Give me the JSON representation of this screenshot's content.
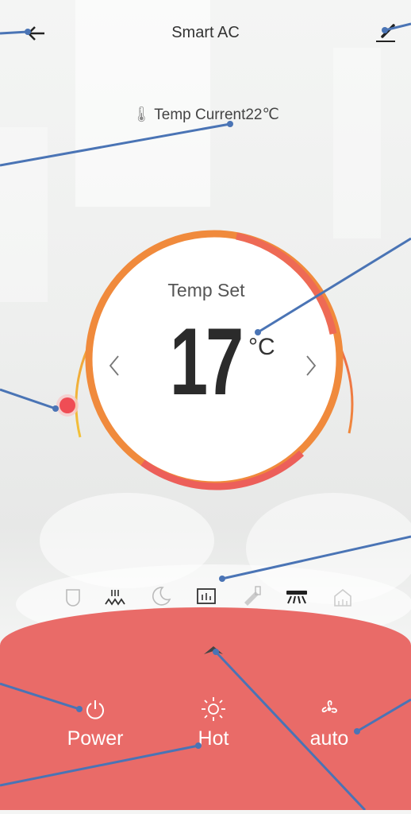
{
  "header": {
    "title": "Smart AC",
    "back_icon": "back-arrow-icon",
    "edit_icon": "edit-pen-icon"
  },
  "current_temp": {
    "label": "Temp Current22℃",
    "icon": "thermometer-icon"
  },
  "dial": {
    "label": "Temp Set",
    "value": "17",
    "unit": "°C",
    "prev_icon": "chevron-left-icon",
    "next_icon": "chevron-right-icon",
    "colors": {
      "ring": "#f08a3c",
      "accent": "#e94f55",
      "knob": "#ef4d55"
    }
  },
  "modes": [
    {
      "name": "eco-mode-icon",
      "active": false
    },
    {
      "name": "heat-mode-icon",
      "active": true
    },
    {
      "name": "sleep-mode-icon",
      "active": false
    },
    {
      "name": "display-mode-icon",
      "active": true
    },
    {
      "name": "fan-swing-icon",
      "active": false
    },
    {
      "name": "air-flow-icon",
      "active": true
    },
    {
      "name": "clean-mode-icon",
      "active": false
    }
  ],
  "controls": {
    "power_label": "Power",
    "mode_label": "Hot",
    "fan_label": "auto"
  },
  "theme": {
    "panel": "#e96b68",
    "callout": "#4a74b5"
  }
}
